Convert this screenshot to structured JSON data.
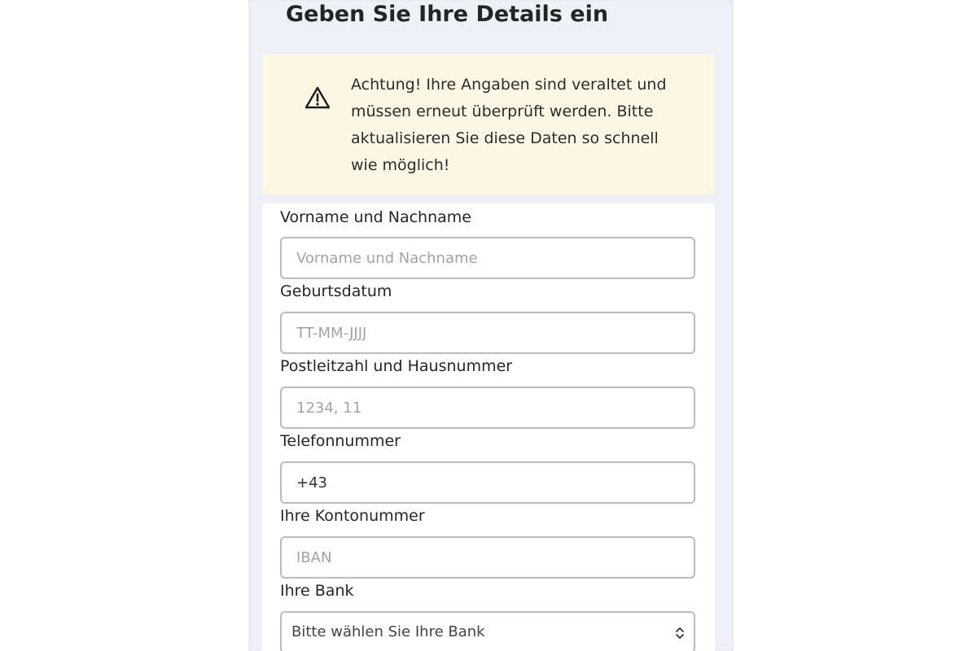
{
  "page": {
    "title": "Geben Sie Ihre Details ein"
  },
  "alert": {
    "icon": "warning-triangle-icon",
    "message": "Achtung! Ihre Angaben sind veraltet und müssen erneut überprüft werden. Bitte aktualisieren Sie diese Daten so schnell wie möglich!",
    "background": "#fdf8e5"
  },
  "form": {
    "fields": {
      "name": {
        "label": "Vorname und Nachname",
        "placeholder": "Vorname und Nachname",
        "value": ""
      },
      "birthdate": {
        "label": "Geburtsdatum",
        "placeholder": "TT-MM-JJJJ",
        "value": ""
      },
      "postal": {
        "label": "Postleitzahl und Hausnummer",
        "placeholder": "1234, 11",
        "value": ""
      },
      "phone": {
        "label": "Telefonnummer",
        "placeholder": "",
        "value": "+43"
      },
      "account": {
        "label": "Ihre Kontonummer",
        "placeholder": "IBAN",
        "value": ""
      },
      "bank": {
        "label": "Ihre Bank",
        "selected": "Bitte wählen Sie Ihre Bank",
        "icon": "chevron-up-down-icon"
      }
    }
  },
  "colors": {
    "page_background": "#eef1f6",
    "card_background": "#ffffff",
    "input_border": "#b8bcc2"
  }
}
